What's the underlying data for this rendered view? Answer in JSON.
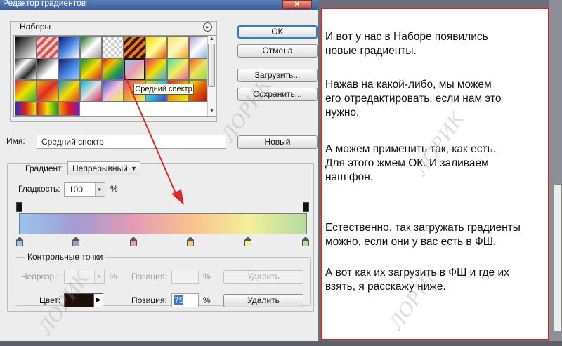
{
  "dialog": {
    "title": "Редактор градиентов",
    "close_glyph": "✕",
    "presets_label": "Наборы",
    "menu_glyph": "▸",
    "tooltip": "Средний спектр",
    "buttons": {
      "ok": "OK",
      "cancel": "Отмена",
      "load": "Загрузить...",
      "save": "Сохранить...",
      "new": "Новый"
    },
    "name_label": "Имя:",
    "name_value": "Средний спектр",
    "gradient_type_label": "Градиент:",
    "gradient_type_value": "Непрерывный",
    "smoothness_label": "Гладкость:",
    "smoothness_value": "100",
    "percent": "%",
    "control_points_label": "Контрольные точки",
    "opacity_label": "Непрозр.:",
    "position_label": "Позиция:",
    "delete_label": "Удалить",
    "color_label": "Цвет:",
    "color_value": "#1f0d0a",
    "position_value": "75",
    "stop_colors": [
      "#9ac4ee",
      "#a59bd3",
      "#e49bb3",
      "#f7c38c",
      "#f4ef9a",
      "#b3dca0"
    ]
  },
  "note": {
    "p1": [
      "И вот у нас в Наборе появились",
      "новые градиенты."
    ],
    "p2": [
      "Нажав на какой-либо, мы можем",
      "его отредактировать, если нам это",
      "нужно."
    ],
    "p3": [
      "А можем применить так, как есть.",
      "Для этого жмем ОК.  И заливаем",
      "наш фон."
    ],
    "p4": [
      "Естественно,  так загружать градиенты",
      "можно, если они у вас есть в ФШ."
    ],
    "p5": [
      "А вот как их загрузить в ФШ и где их",
      "взять, я расскажу ниже."
    ]
  },
  "watermark": "ЛОРИК",
  "colors": {
    "annotation_border": "#d42b2b",
    "arrow": "#e02828",
    "focus": "#3b79c9"
  }
}
